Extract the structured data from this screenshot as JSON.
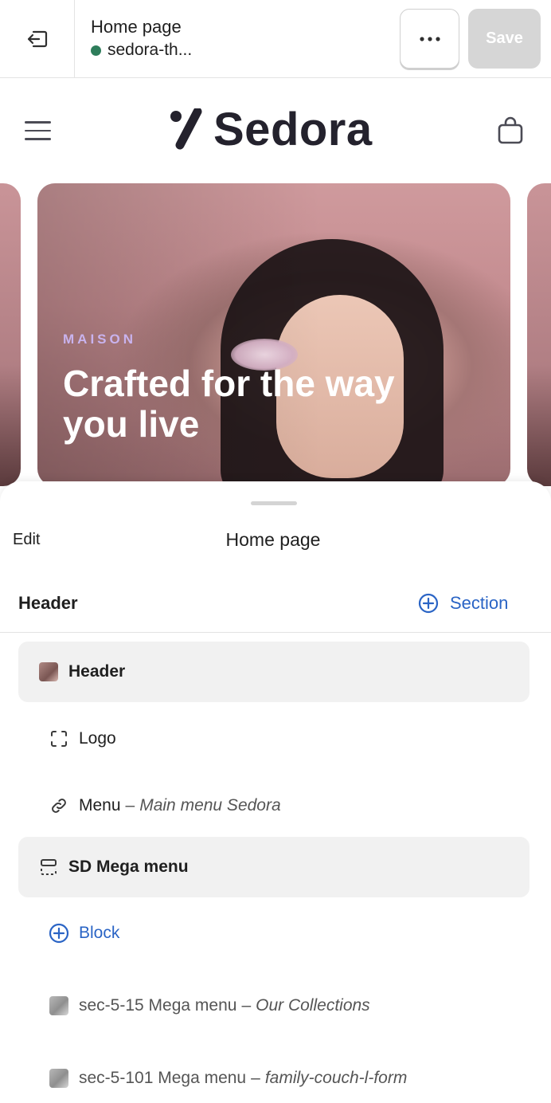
{
  "topbar": {
    "page_name": "Home page",
    "theme_name": "sedora-th...",
    "save_label": "Save",
    "more_icon": "ellipsis-icon",
    "exit_icon": "exit-icon"
  },
  "storefront": {
    "brand": "Sedora",
    "hero": {
      "eyebrow": "MAISON",
      "headline": "Crafted for the way you live"
    }
  },
  "sheet": {
    "edit_label": "Edit",
    "title": "Home page",
    "group_title": "Header",
    "add_section_label": "Section",
    "items": [
      {
        "label": "Header",
        "sub": "",
        "icon": "header-thumbnail"
      },
      {
        "label": "Logo",
        "sub": "",
        "icon": "logo-frame-icon"
      },
      {
        "label": "Menu",
        "sub": "Main menu Sedora",
        "icon": "link-icon"
      },
      {
        "label": "SD Mega menu",
        "sub": "",
        "icon": "mega-menu-icon"
      },
      {
        "label": "Block",
        "sub": "",
        "icon": "add-block-icon"
      },
      {
        "label": "sec-5-15 Mega menu",
        "sub": "Our Collections",
        "icon": "image-thumbnail"
      },
      {
        "label": "sec-5-101 Mega menu",
        "sub": "family-couch-l-form",
        "icon": "image-thumbnail"
      }
    ],
    "separator": "–"
  },
  "colors": {
    "accent": "#2a64c5",
    "status_dot": "#2e7d5b",
    "save_disabled": "#d6d6d6",
    "hero_eyebrow": "#c9b3ee"
  }
}
